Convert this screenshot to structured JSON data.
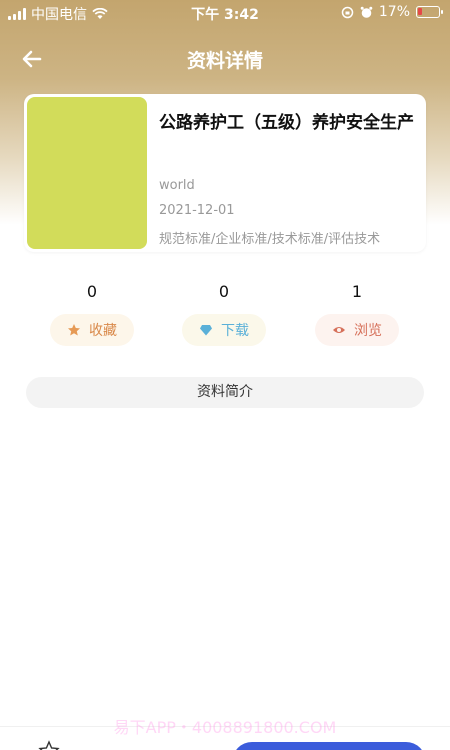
{
  "status_bar": {
    "carrier": "中国电信",
    "time": "下午 3:42",
    "battery": "17%"
  },
  "nav": {
    "title": "资料详情",
    "back_icon": "arrow-left-icon"
  },
  "document": {
    "title": "公路养护工（五级）养护安全生产",
    "author": "world",
    "date": "2021-12-01",
    "tags": "规范标准/企业标准/技术标准/评估技术",
    "cover_color": "#d2dc5a"
  },
  "stats": [
    {
      "count": "0",
      "label": "收藏",
      "icon": "star-icon"
    },
    {
      "count": "0",
      "label": "下载",
      "icon": "diamond-icon"
    },
    {
      "count": "1",
      "label": "浏览",
      "icon": "eye-icon"
    }
  ],
  "intro": {
    "label": "资料简介"
  },
  "watermark": "易下APP・4008891800.COM",
  "colors": {
    "header_gold": "#c3a56e",
    "accent_blue": "#3b5cdb"
  }
}
